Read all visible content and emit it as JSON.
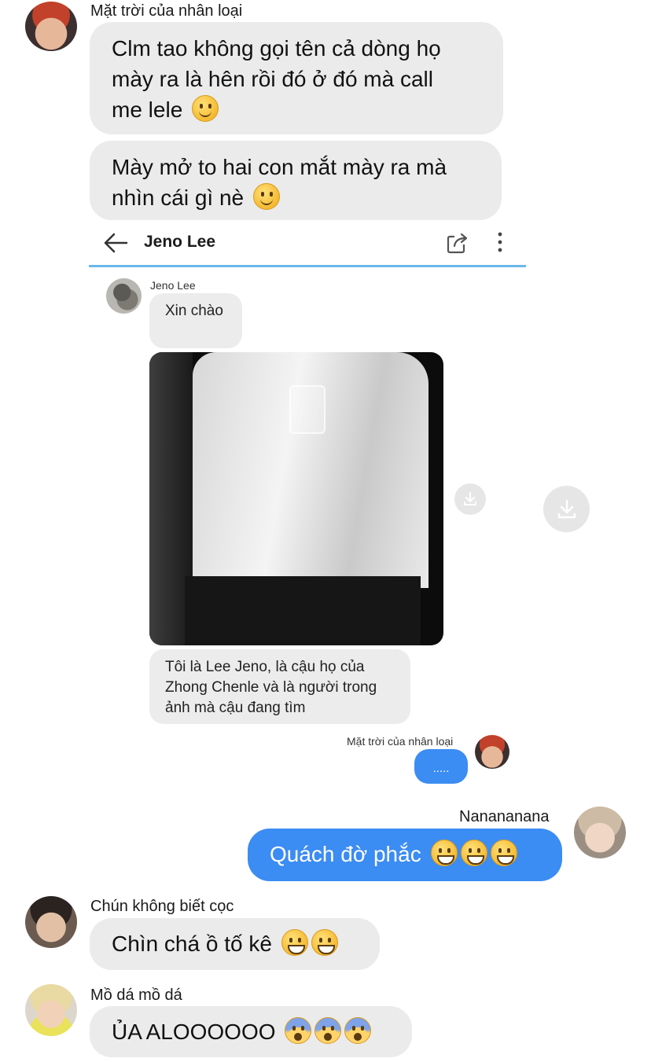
{
  "messages": [
    {
      "sender": "Mặt trời của nhân loại",
      "bubbles": [
        "Clm tao không gọi tên cả dòng họ mày ra là hên rồi đó ở đó mà call me lele",
        "Mày mở to hai con mắt mày ra mà nhìn cái gì nè"
      ]
    },
    {
      "sender": "Nanananana",
      "bubbles": [
        "Quách đờ phắc"
      ]
    },
    {
      "sender": "Chún không biết cọc",
      "bubbles": [
        "Chìn chá ồ tố kê"
      ]
    },
    {
      "sender": "Mồ dá mồ dá",
      "bubbles": [
        "ỦA ALOOOOOO"
      ]
    }
  ],
  "bubble_lines": {
    "m1_b1": [
      "Clm tao không gọi tên cả dòng họ",
      "mày ra là hên rồi đó ở đó mà call",
      "me lele"
    ],
    "m1_b2": [
      "Mày mở to hai con mắt mày ra mà",
      "nhìn cái gì nè"
    ]
  },
  "embedded": {
    "title": "Jeno Lee",
    "sender": "Jeno Lee",
    "greeting": "Xin chào",
    "caption_lines": [
      "Tôi là Lee Jeno, là cậu họ của",
      "Zhong Chenle và là người trong",
      "ảnh mà cậu đang tìm"
    ],
    "reply_sender": "Mặt trời của nhân loại",
    "reply_text": "....."
  },
  "icons": [
    "back-arrow-icon",
    "share-icon",
    "more-vertical-icon",
    "download-icon"
  ],
  "colors": {
    "blue_bubble": "#3b8cf3",
    "gray_bubble": "#ebebeb",
    "embed_accent": "#6ab8ea"
  }
}
